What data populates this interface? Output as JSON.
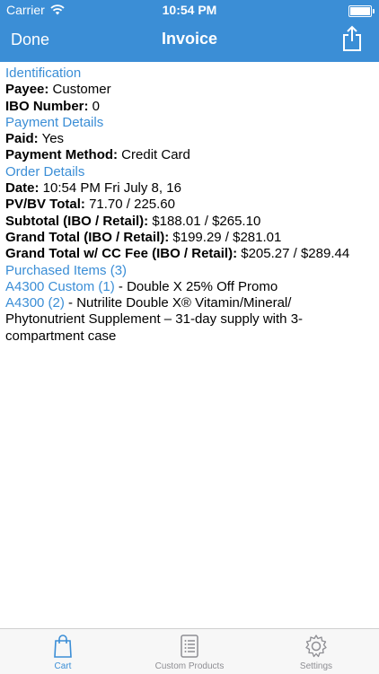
{
  "status": {
    "carrier": "Carrier",
    "time": "10:54 PM"
  },
  "nav": {
    "left": "Done",
    "title": "Invoice",
    "right_icon": "share-icon"
  },
  "invoice": {
    "identification": "Identification",
    "payee_label": "Payee:",
    "payee_value": " Customer",
    "ibo_label": "IBO Number:",
    "ibo_value": " 0",
    "payment_details": "Payment Details",
    "paid_label": "Paid:",
    "paid_value": " Yes",
    "method_label": "Payment Method:",
    "method_value": " Credit Card",
    "order_details": "Order Details",
    "date_label": "Date:",
    "date_value": " 10:54 PM Fri July 8, 16",
    "pvbv_label": "PV/BV Total:",
    "pvbv_value": " 71.70 / 225.60",
    "subtotal_label": "Subtotal (IBO / Retail):",
    "subtotal_value": " $188.01 / $265.10",
    "grand_label": "Grand Total (IBO / Retail):",
    "grand_value": " $199.29 / $281.01",
    "ccfee_label": "Grand Total w/ CC Fee (IBO / Retail):",
    "ccfee_value": " $205.27 / $289.44",
    "purchased": "Purchased Items (3)",
    "items": [
      {
        "code": "A4300 Custom (1)",
        "desc": " - Double X 25% Off Promo"
      },
      {
        "code": "A4300  (2)",
        "desc": " - Nutrilite Double X® Vitamin/Mineral/ Phytonutrient Supplement – 31-day supply with 3-compartment case"
      }
    ]
  },
  "tabs": [
    {
      "label": "Cart",
      "icon": "bag-icon",
      "active": true
    },
    {
      "label": "Custom Products",
      "icon": "list-icon",
      "active": false
    },
    {
      "label": "Settings",
      "icon": "gear-icon",
      "active": false
    }
  ],
  "colors": {
    "accent": "#3b8ed6",
    "tab_inactive": "#8e8e93"
  }
}
